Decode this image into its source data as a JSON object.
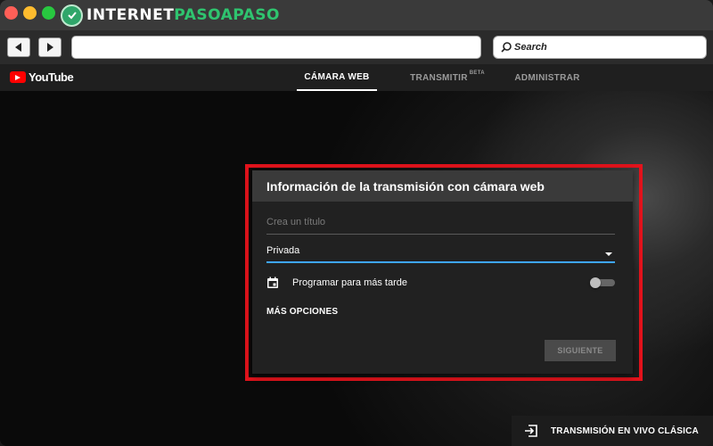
{
  "brand": {
    "logo_prefix": "INTERNET",
    "logo_accent": "PASOAPASO"
  },
  "browser": {
    "search_placeholder": "Search",
    "url_value": ""
  },
  "youtube": {
    "logo_text": "YouTube",
    "tabs": [
      {
        "label": "CÁMARA WEB",
        "active": true
      },
      {
        "label": "TRANSMITIR",
        "badge": "BETA",
        "active": false
      },
      {
        "label": "ADMINISTRAR",
        "active": false
      }
    ]
  },
  "dialog": {
    "title": "Información de la transmisión con cámara web",
    "title_placeholder": "Crea un título",
    "privacy_value": "Privada",
    "schedule_label": "Programar para más tarde",
    "schedule_enabled": false,
    "more_options": "MÁS OPCIONES",
    "next_button": "SIGUIENTE"
  },
  "footer": {
    "classic_label": "TRANSMISIÓN EN VIVO CLÁSICA"
  },
  "colors": {
    "highlight": "#e3131c",
    "accent_underline": "#3ea6ff",
    "youtube_red": "#ff0000",
    "brand_green": "#2fc46f"
  }
}
